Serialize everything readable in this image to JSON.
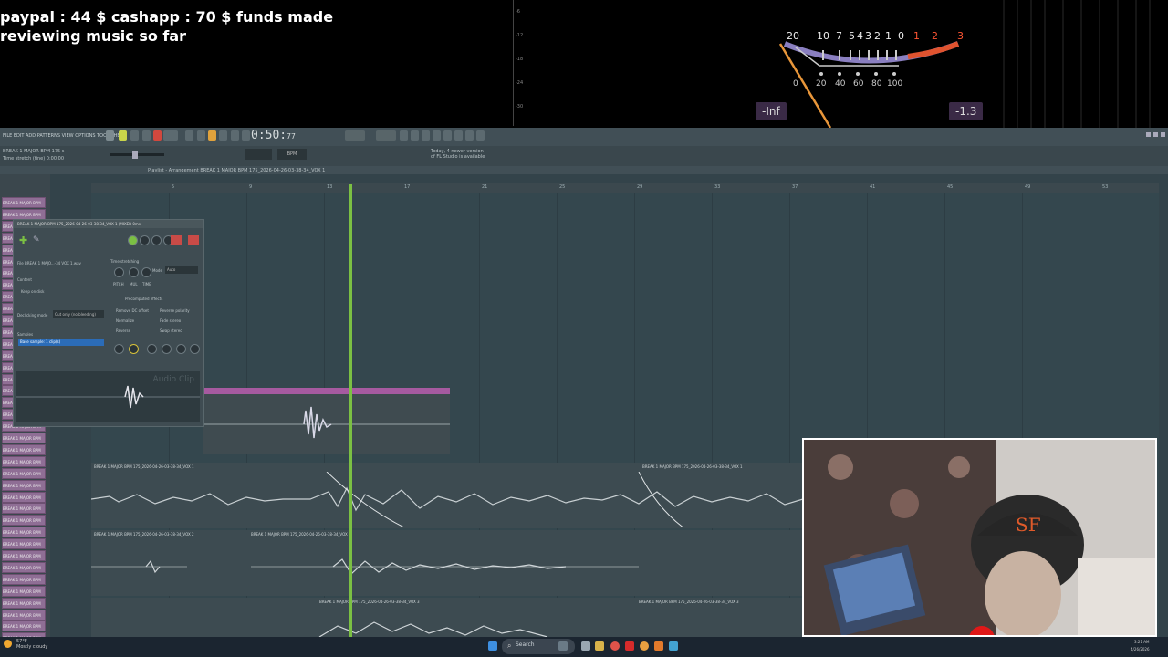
{
  "overlay": {
    "donation_line1": "paypal : 44 $  cashapp : 70 $ funds made",
    "donation_line2": "reviewing music so far"
  },
  "vu_meter": {
    "scale_top": [
      "20",
      "10",
      "7",
      "5",
      "4",
      "3",
      "2",
      "1",
      "0"
    ],
    "scale_red": [
      "1",
      "2",
      "3"
    ],
    "scale_bottom": [
      "0",
      "20",
      "40",
      "60",
      "80",
      "100"
    ],
    "left_readout": "-Inf",
    "right_readout": "-1.3"
  },
  "fl_studio": {
    "menu_text": "FILE EDIT ADD PATTERNS VIEW OPTIONS TOOLS HELP",
    "time": "0:50:",
    "time_small": "77",
    "project_label": "BREAK 1 MAJOR BPM 175 s",
    "sub_label": "Time stretch (fine)  0:00:00",
    "tempo_label": "BPM",
    "hint_text": "Today, 4 newer version of FL Studio is available",
    "playlist_title": "Playlist - Arrangement  BREAK 1 MAJOR BPM 175_2026-04-26-03-38-34_VOX 1",
    "ruler_marks": [
      "5",
      "9",
      "13",
      "17",
      "21",
      "25",
      "29",
      "33",
      "37",
      "41",
      "45",
      "49",
      "53",
      "57"
    ],
    "track_label": "BREAK 1 MAJOR BPM 175",
    "channel_window": {
      "title": "BREAK 1 MAJOR BPM 175_2026-04-26-03-38-34_VOX 1 (MIXER 0ms)",
      "file_label": "File  BREAK 1 MAJO...-34 VOX 1.wav",
      "time_stretching": "Time stretching",
      "mode_label": "Mode",
      "mode_value": "Auto",
      "content_label": "Content",
      "keep_on_disk": "Keep on disk",
      "declicking": "Declicking mode",
      "declicking_value": "Out only (no bleeding)",
      "precomputed": "Precomputed effects",
      "remove_dc": "Remove DC offset",
      "normalize": "Normalize",
      "reverse": "Reverse",
      "reverse_polarity": "Reverse polarity",
      "fade_stereo": "Fade stereo",
      "swap_stereo": "Swap stereo",
      "sample_label": "Samples",
      "sample_selected": "Base sample: 1 clip(s)",
      "audio_clip": "Audio Clip",
      "knob_labels": [
        "PITCH",
        "MUL",
        "TIME"
      ]
    },
    "clip_labels": [
      "BREAK 1 MAJOR BPM 175_2026-04-26-03-38-34_VOX 1",
      "BREAK 1 MAJOR BPM 175_2026-04-26-03-38-34_VOX 1",
      "BREAK 1 MAJOR BPM 175_2026-04-26-03-38-34_VOX 2",
      "BREAK 1 MAJOR BPM 175_2026-04-26-03-38-34_VOX 2",
      "BREAK 1 MAJOR BPM 175_2026-04-26-03-38-34_VOX 3",
      "BREAK 1 MAJOR BPM 175_2026-04-26-03-38-34_VOX 3"
    ]
  },
  "taskbar": {
    "weather": "57°F\nMostly cloudy",
    "search": "Search",
    "clock_time": "3:21 AM",
    "clock_date": "4/26/2026"
  }
}
